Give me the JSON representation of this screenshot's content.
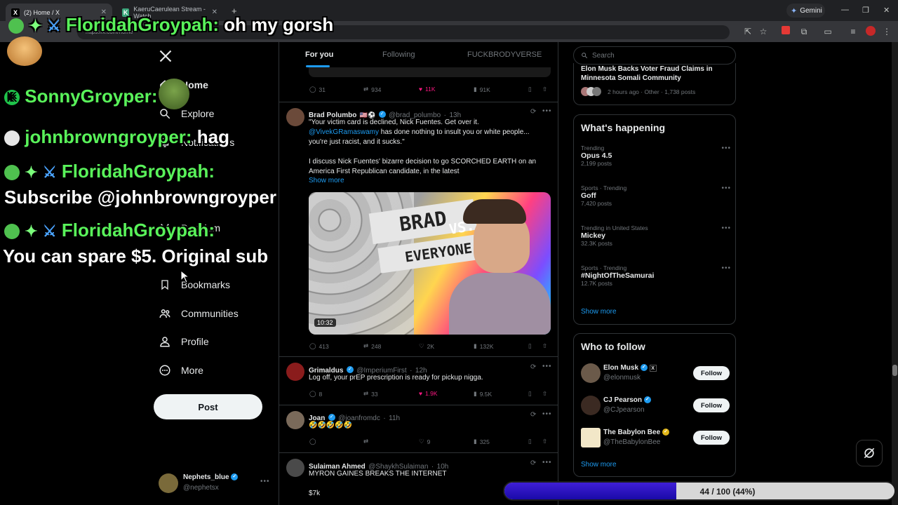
{
  "browser": {
    "tabs": [
      {
        "label": "(2) Home / X",
        "favicon": "X"
      },
      {
        "label": "KaeruCaerulean Stream - Watch",
        "favicon": "K"
      }
    ],
    "new_tab_label": "+",
    "url": "https://x.com/home",
    "gemini_label": "Gemini"
  },
  "sidebar": {
    "items": [
      {
        "label": "Home"
      },
      {
        "label": "Explore"
      },
      {
        "label": "Notifications"
      },
      {
        "label": "Premium"
      },
      {
        "label": "Bookmarks"
      },
      {
        "label": "Communities"
      },
      {
        "label": "Profile"
      },
      {
        "label": "More"
      }
    ],
    "post_label": "Post",
    "account": {
      "name": "Nephets_blue",
      "handle": "@nephetsx"
    }
  },
  "feed": {
    "tabs": [
      "For you",
      "Following",
      "FUCKBRODYVERSE"
    ],
    "top_actions": {
      "replies": "31",
      "reposts": "934",
      "likes": "11K",
      "views": "91K"
    },
    "posts": [
      {
        "name": "Brad Polumbo",
        "flags": "🇺🇸⚽",
        "handle": "@brad_polumbo",
        "time": "13h",
        "line1": "\"Your victim card is declined, Nick Fuentes. Get over it.",
        "mention": "@VivekGRamaswamy",
        "line2": " has done nothing to insult you or white people...",
        "line3": "you're just racist, and it sucks.\"",
        "line4": "I discuss Nick Fuentes' bizarre decision to go SCORCHED EARTH on an",
        "line5": "America First Republican candidate, in the latest",
        "show_more": "Show more",
        "media_text_1": "BRAD",
        "media_text_2": "VS.",
        "media_text_3": "EVERYONE",
        "duration": "10:32",
        "replies": "413",
        "reposts": "248",
        "likes": "2K",
        "views": "132K"
      },
      {
        "name": "Grimaldus",
        "handle": "@ImperiumFirst",
        "time": "12h",
        "text": "Log off, your prEP prescription is ready for pickup nigga.",
        "replies": "8",
        "reposts": "33",
        "likes": "1.9K",
        "views": "9.5K"
      },
      {
        "name": "Joan",
        "handle": "@joanfromdc",
        "time": "11h",
        "text": "🤣🤣🤣🤣🤣",
        "replies": "",
        "reposts": "",
        "likes": "9",
        "views": "325"
      },
      {
        "name": "Sulaiman Ahmed",
        "handle": "@ShaykhSulaiman",
        "time": "10h",
        "text": "MYRON GAINES BREAKS THE INTERNET",
        "text2": "$7k"
      }
    ]
  },
  "right": {
    "search_placeholder": "Search",
    "top_story": {
      "title": "Elon Musk Backs Voter Fraud Claims in Minnesota Somali Community",
      "meta": "2 hours ago · Other · 1,738 posts"
    },
    "happening_title": "What's happening",
    "trends": [
      {
        "meta": "Trending",
        "name": "Opus 4.5",
        "posts": "2,199 posts"
      },
      {
        "meta": "Sports · Trending",
        "name": "Goff",
        "posts": "7,420 posts"
      },
      {
        "meta": "Trending in United States",
        "name": "Mickey",
        "posts": "32.3K posts"
      },
      {
        "meta": "Sports · Trending",
        "name": "#NightOfTheSamurai",
        "posts": "12.7K posts"
      }
    ],
    "show_more": "Show more",
    "follow_title": "Who to follow",
    "follow": [
      {
        "name": "Elon Musk",
        "handle": "@elonmusk",
        "button": "Follow"
      },
      {
        "name": "CJ Pearson",
        "handle": "@CJpearson",
        "button": "Follow"
      },
      {
        "name": "The Babylon Bee",
        "handle": "@TheBabylonBee",
        "button": "Follow"
      }
    ],
    "follow_show_more": "Show more"
  },
  "overlay": {
    "chat": [
      {
        "user": "FloridahGroypah:",
        "msg": "oh my gorsh"
      },
      {
        "user": "SonnyGroyper:",
        "msg": ""
      },
      {
        "user": "johnbrowngroyper:",
        "msg": "hag"
      },
      {
        "user": "FloridahGroypah:",
        "msg": ""
      },
      {
        "user": "",
        "msg": "Subscribe @johnbrowngroyper"
      },
      {
        "user": "FloridahGroypah:",
        "msg": ""
      },
      {
        "user": "",
        "msg": "You can spare $5. Original sub"
      }
    ],
    "progress": {
      "current": 44,
      "goal": 100,
      "label": "44 / 100 (44%)",
      "fraction": 0.44
    }
  }
}
